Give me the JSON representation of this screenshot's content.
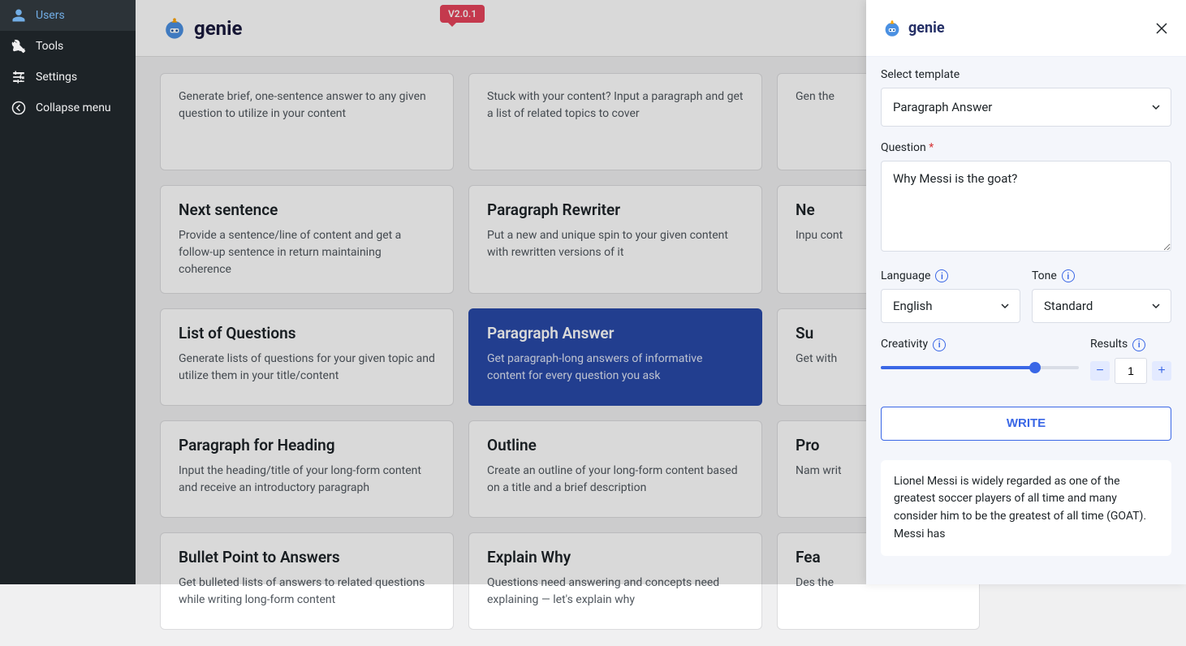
{
  "sidebar": {
    "items": [
      {
        "label": "Users"
      },
      {
        "label": "Tools"
      },
      {
        "label": "Settings"
      },
      {
        "label": "Collapse menu"
      }
    ]
  },
  "header": {
    "logo_text": "genie",
    "version": "V2.0.1"
  },
  "cards": [
    {
      "title": "",
      "desc": "Generate brief, one-sentence answer to any given question to utilize in your content"
    },
    {
      "title": "",
      "desc": "Stuck with your content? Input a paragraph and get a list of related topics to cover"
    },
    {
      "title": "",
      "desc": "Gen\nthe"
    },
    {
      "title": "Next sentence",
      "desc": "Provide a sentence/line of content and get a follow-up sentence in return maintaining coherence"
    },
    {
      "title": "Paragraph Rewriter",
      "desc": "Put a new and unique spin to your given content with rewritten versions of it"
    },
    {
      "title": "Ne",
      "desc": "Inpu\ncont"
    },
    {
      "title": "List of Questions",
      "desc": "Generate lists of questions for your given topic and utilize them in your title/content"
    },
    {
      "title": "Paragraph Answer",
      "desc": "Get paragraph-long answers of informative content for every question you ask"
    },
    {
      "title": "Su",
      "desc": "Get\nwith"
    },
    {
      "title": "Paragraph for Heading",
      "desc": "Input the heading/title of your long-form content and receive an introductory paragraph"
    },
    {
      "title": "Outline",
      "desc": "Create an outline of your long-form content based on a title and a brief description"
    },
    {
      "title": "Pro",
      "desc": "Nam\nwrit"
    },
    {
      "title": "Bullet Point to Answers",
      "desc": "Get bulleted lists of answers to related questions while writing long-form content"
    },
    {
      "title": "Explain Why",
      "desc": "Questions need answering and concepts need explaining — let's explain why"
    },
    {
      "title": "Fea",
      "desc": "Des\nthe"
    }
  ],
  "panel": {
    "logo_text": "genie",
    "select_template_label": "Select template",
    "template_value": "Paragraph Answer",
    "question_label": "Question",
    "question_value": "Why Messi is the goat?",
    "language_label": "Language",
    "language_value": "English",
    "tone_label": "Tone",
    "tone_value": "Standard",
    "creativity_label": "Creativity",
    "results_label": "Results",
    "results_value": "1",
    "write_label": "WRITE",
    "result_text": "Lionel Messi is widely regarded as one of the greatest soccer players of all time and many consider him to be the greatest of all time (GOAT). Messi has"
  }
}
